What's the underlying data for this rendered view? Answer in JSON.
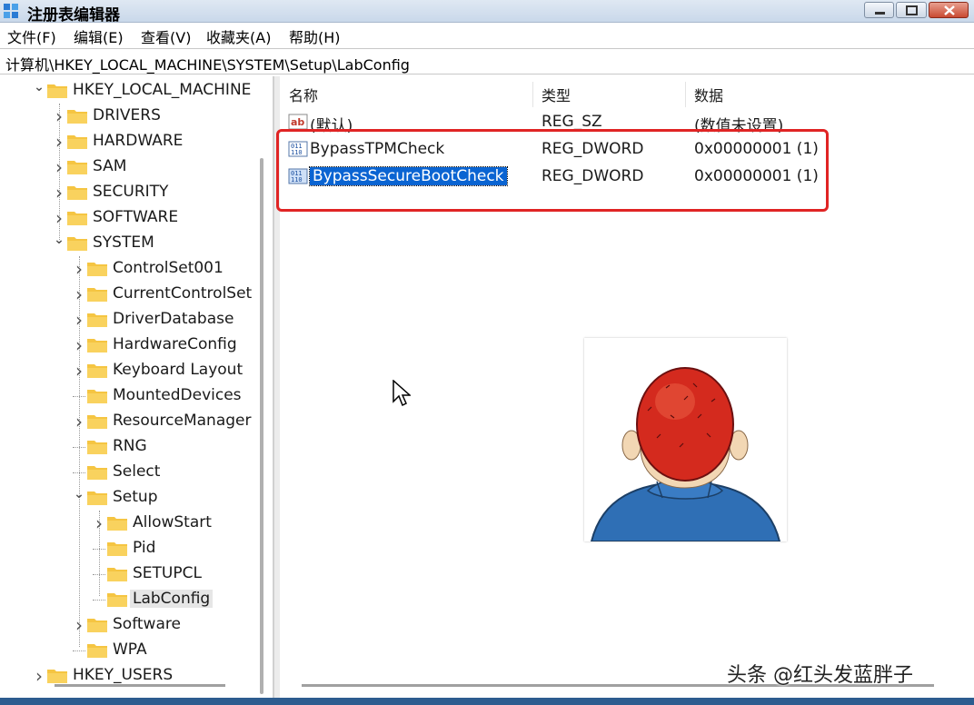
{
  "window": {
    "title": "注册表编辑器",
    "controls": {
      "minimize": "minimize-icon",
      "maximize": "maximize-icon",
      "close": "close-icon"
    }
  },
  "menu": [
    {
      "label": "文件(F)"
    },
    {
      "label": "编辑(E)"
    },
    {
      "label": "查看(V)"
    },
    {
      "label": "收藏夹(A)"
    },
    {
      "label": "帮助(H)"
    }
  ],
  "address": "计算机\\HKEY_LOCAL_MACHINE\\SYSTEM\\Setup\\LabConfig",
  "tree": [
    {
      "label": "HKEY_LOCAL_MACHINE",
      "level": 0,
      "expanded": true
    },
    {
      "label": "DRIVERS",
      "level": 1,
      "chevron": true
    },
    {
      "label": "HARDWARE",
      "level": 1,
      "chevron": true
    },
    {
      "label": "SAM",
      "level": 1,
      "chevron": true
    },
    {
      "label": "SECURITY",
      "level": 1,
      "chevron": true
    },
    {
      "label": "SOFTWARE",
      "level": 1,
      "chevron": true
    },
    {
      "label": "SYSTEM",
      "level": 1,
      "expanded": true
    },
    {
      "label": "ControlSet001",
      "level": 2,
      "chevron": true
    },
    {
      "label": "CurrentControlSet",
      "level": 2,
      "chevron": true
    },
    {
      "label": "DriverDatabase",
      "level": 2,
      "chevron": true
    },
    {
      "label": "HardwareConfig",
      "level": 2,
      "chevron": true
    },
    {
      "label": "Keyboard Layout",
      "level": 2,
      "chevron": true
    },
    {
      "label": "MountedDevices",
      "level": 2,
      "chevron": false
    },
    {
      "label": "ResourceManager",
      "level": 2,
      "chevron": true
    },
    {
      "label": "RNG",
      "level": 2,
      "chevron": false
    },
    {
      "label": "Select",
      "level": 2,
      "chevron": false
    },
    {
      "label": "Setup",
      "level": 2,
      "expanded": true
    },
    {
      "label": "AllowStart",
      "level": 3,
      "chevron": true
    },
    {
      "label": "Pid",
      "level": 3,
      "chevron": false
    },
    {
      "label": "SETUPCL",
      "level": 3,
      "chevron": false
    },
    {
      "label": "LabConfig",
      "level": 3,
      "chevron": false,
      "selected": true
    },
    {
      "label": "Software",
      "level": 2,
      "chevron": true
    },
    {
      "label": "WPA",
      "level": 2,
      "chevron": false
    },
    {
      "label": "HKEY_USERS",
      "level": 0,
      "chevron": true
    }
  ],
  "columns": {
    "name": "名称",
    "type": "类型",
    "data": "数据"
  },
  "values": [
    {
      "name": "(默认)",
      "type": "REG_SZ",
      "data": "(数值未设置)",
      "icon": "string-value-icon"
    },
    {
      "name": "BypassTPMCheck",
      "type": "REG_DWORD",
      "data": "0x00000001 (1)",
      "icon": "binary-value-icon"
    },
    {
      "name": "BypassSecureBootCheck",
      "type": "REG_DWORD",
      "data": "0x00000001 (1)",
      "icon": "binary-value-icon",
      "selected": true
    }
  ],
  "watermark": "头条 @红头发蓝胖子",
  "colors": {
    "highlight_box": "#e02424",
    "selection": "#0a64d2",
    "folder": "#f5c542"
  }
}
